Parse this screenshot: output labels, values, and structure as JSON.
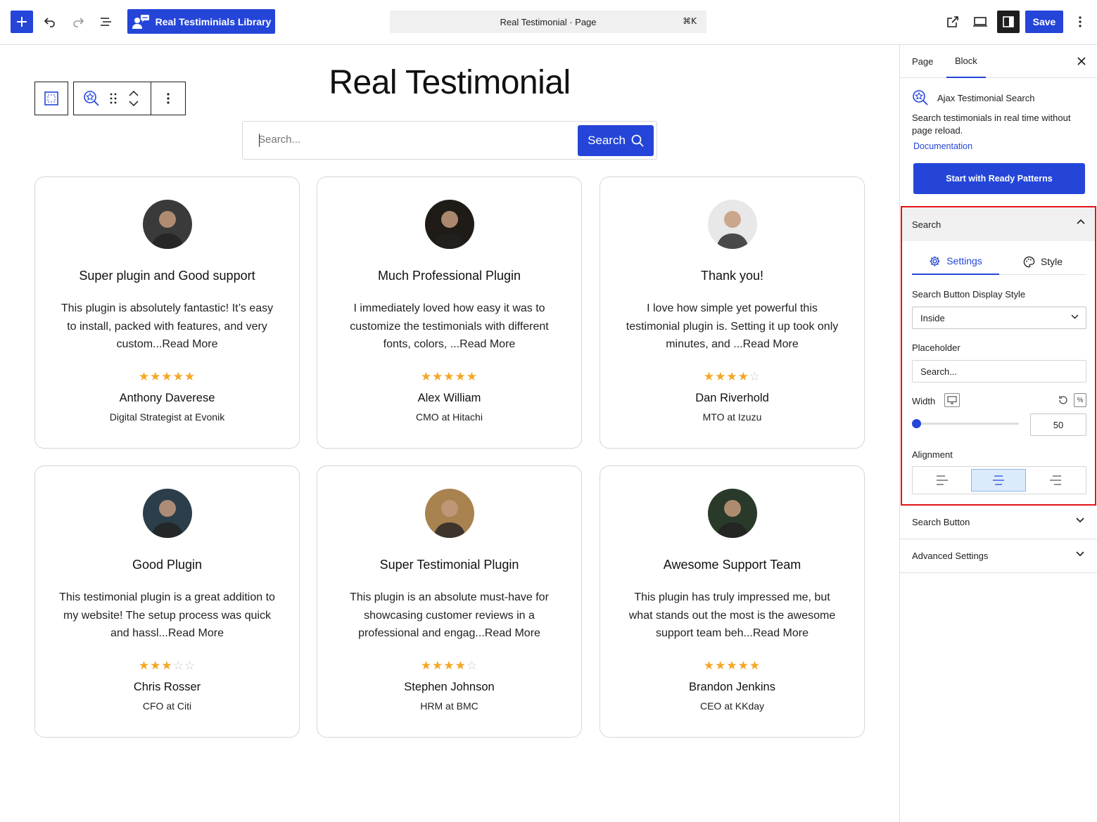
{
  "topbar": {
    "library_button": "Real Testiminials Library",
    "command_title": "Real Testimonial · Page",
    "command_shortcut": "⌘K",
    "save_label": "Save"
  },
  "canvas": {
    "page_title": "Real Testimonial",
    "search": {
      "placeholder": "Search...",
      "button_label": "Search"
    },
    "testimonials": [
      {
        "title": "Super plugin and Good support",
        "body": "This plugin is absolutely fantastic! It’s easy to install, packed with features, and very custom...Read More",
        "rating": 5,
        "name": "Anthony Daverese",
        "role": "Digital Strategist at Evonik",
        "avatar_color": "#3a3a3a"
      },
      {
        "title": "Much Professional Plugin",
        "body": "I immediately loved how easy it was to customize the testimonials with different fonts, colors, ...Read More",
        "rating": 5,
        "name": "Alex William",
        "role": "CMO at Hitachi",
        "avatar_color": "#1f1c18"
      },
      {
        "title": "Thank you!",
        "body": "I love how simple yet powerful this testimonial plugin is. Setting it up took only minutes, and ...Read More",
        "rating": 4,
        "name": "Dan Riverhold",
        "role": "MTO at Izuzu",
        "avatar_color": "#e8e8e8"
      },
      {
        "title": "Good Plugin",
        "body": "This testimonial plugin is a great addition to my website! The setup process was quick and hassl...Read More",
        "rating": 3,
        "name": "Chris Rosser",
        "role": "CFO at Citi",
        "avatar_color": "#2c3e4a"
      },
      {
        "title": "Super Testimonial Plugin",
        "body": "This plugin is an absolute must-have for showcasing customer reviews in a professional and engag...Read More",
        "rating": 4,
        "name": "Stephen Johnson",
        "role": "HRM at BMC",
        "avatar_color": "#a8824f"
      },
      {
        "title": "Awesome Support Team",
        "body": "This plugin has truly impressed me, but what stands out the most is the awesome support team beh...Read More",
        "rating": 5,
        "name": "Brandon Jenkins",
        "role": "CEO at KKday",
        "avatar_color": "#2a3a2a"
      }
    ]
  },
  "sidebar": {
    "tabs": {
      "page": "Page",
      "block": "Block"
    },
    "block_name": "Ajax Testimonial Search",
    "block_description": "Search testimonials in real time without page reload.",
    "documentation_link": "Documentation",
    "ready_patterns_button": "Start with Ready Patterns",
    "search_panel": {
      "title": "Search",
      "tab_settings": "Settings",
      "tab_style": "Style",
      "display_style_label": "Search Button Display Style",
      "display_style_value": "Inside",
      "placeholder_label": "Placeholder",
      "placeholder_value": "Search...",
      "width_label": "Width",
      "width_unit": "%",
      "width_value": "50",
      "alignment_label": "Alignment",
      "alignment_selected": "center"
    },
    "search_button_section": "Search Button",
    "advanced_section": "Advanced Settings"
  },
  "colors": {
    "accent": "#2445d8",
    "star": "#f5a623",
    "highlight_border": "#e4131b"
  }
}
